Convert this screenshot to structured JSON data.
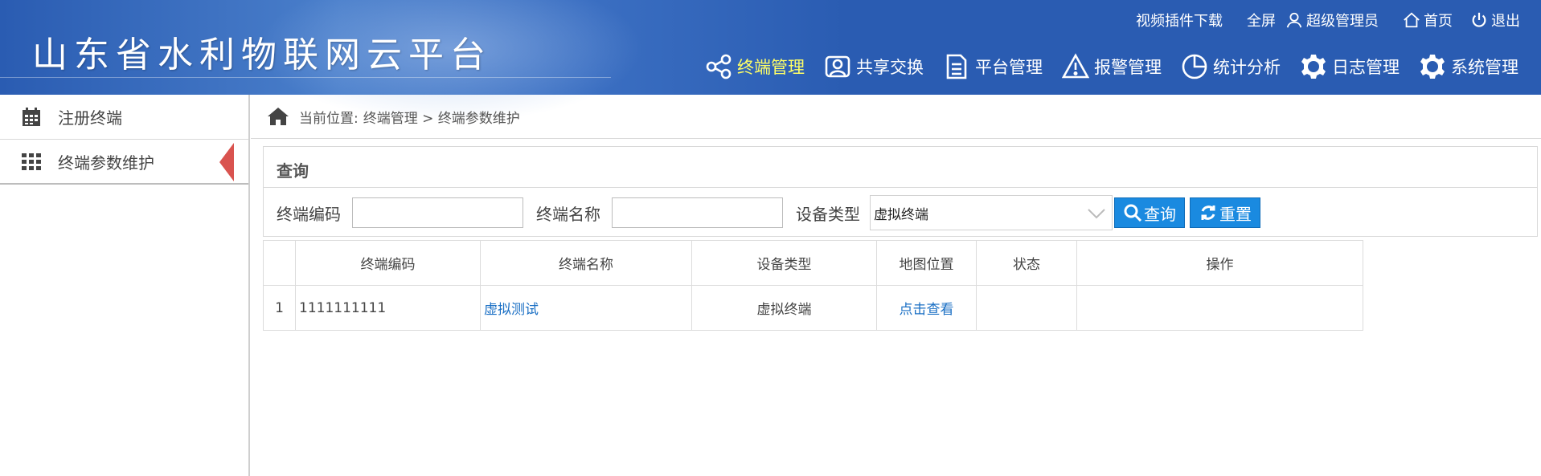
{
  "header": {
    "title": "山东省水利物联网云平台",
    "topbar": [
      {
        "label": "视频插件下载",
        "icon": "none"
      },
      {
        "label": "全屏",
        "icon": "none"
      },
      {
        "label": "超级管理员",
        "icon": "user-icon"
      },
      {
        "label": "首页",
        "icon": "home-icon"
      },
      {
        "label": "退出",
        "icon": "power-icon"
      }
    ],
    "nav": [
      {
        "label": "终端管理",
        "icon": "share-nodes-icon",
        "active": true
      },
      {
        "label": "共享交换",
        "icon": "user-card-icon"
      },
      {
        "label": "平台管理",
        "icon": "document-icon"
      },
      {
        "label": "报警管理",
        "icon": "warning-icon"
      },
      {
        "label": "统计分析",
        "icon": "pie-chart-icon"
      },
      {
        "label": "日志管理",
        "icon": "gear-icon"
      },
      {
        "label": "系统管理",
        "icon": "gear-icon"
      }
    ],
    "colors": {
      "bar": "#2a5cb2",
      "active_nav": "#ffff66"
    }
  },
  "sidebar": {
    "items": [
      {
        "label": "注册终端",
        "icon": "calendar-icon"
      },
      {
        "label": "终端参数维护",
        "icon": "grid-icon",
        "active": true
      }
    ]
  },
  "breadcrumb": {
    "prefix": "当前位置:",
    "path": "终端管理 > 终端参数维护"
  },
  "query": {
    "title": "查询",
    "code_label": "终端编码",
    "code_value": "",
    "name_label": "终端名称",
    "name_value": "",
    "type_label": "设备类型",
    "type_value": "虚拟终端",
    "search_button": "查询",
    "reset_button": "重置"
  },
  "table": {
    "headers": [
      "",
      "终端编码",
      "终端名称",
      "设备类型",
      "地图位置",
      "状态",
      "操作"
    ],
    "rows": [
      {
        "index": "1",
        "code": "1111111111",
        "name": "虚拟测试",
        "type": "虚拟终端",
        "map": "点击查看",
        "status": "",
        "action": ""
      }
    ]
  }
}
